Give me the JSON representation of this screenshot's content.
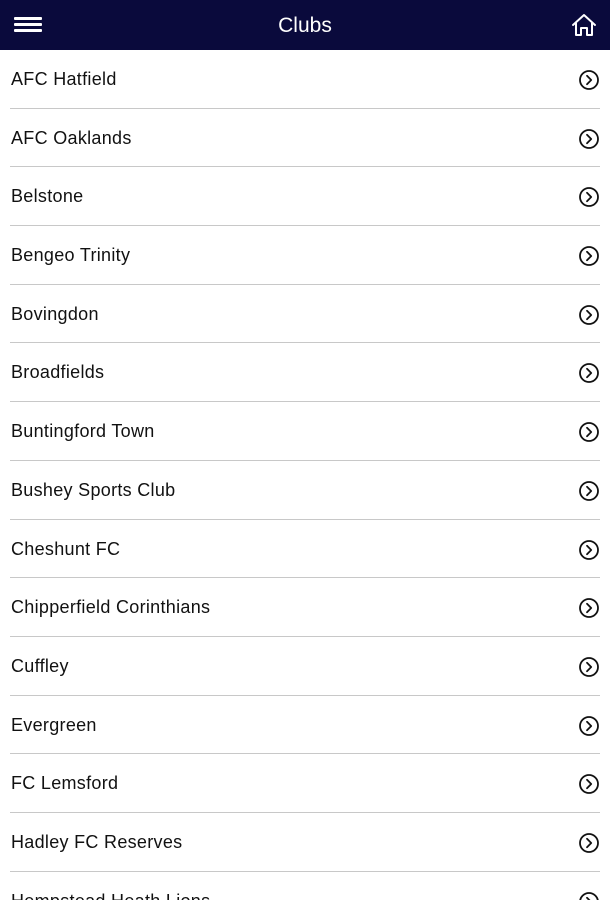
{
  "header": {
    "title": "Clubs",
    "background": "#0a0a3c",
    "menu_icon": "hamburger-menu-icon",
    "home_icon": "home-icon"
  },
  "clubs": [
    {
      "label": "AFC Hatfield"
    },
    {
      "label": "AFC Oaklands"
    },
    {
      "label": "Belstone"
    },
    {
      "label": "Bengeo Trinity"
    },
    {
      "label": "Bovingdon"
    },
    {
      "label": "Broadfields"
    },
    {
      "label": "Buntingford Town"
    },
    {
      "label": "Bushey Sports Club"
    },
    {
      "label": "Cheshunt FC"
    },
    {
      "label": "Chipperfield Corinthians"
    },
    {
      "label": "Cuffley"
    },
    {
      "label": "Evergreen"
    },
    {
      "label": "FC Lemsford"
    },
    {
      "label": "Hadley FC Reserves"
    },
    {
      "label": "Hempstead Heath Lions"
    }
  ],
  "row_icon": "chevron-right-circle-icon"
}
